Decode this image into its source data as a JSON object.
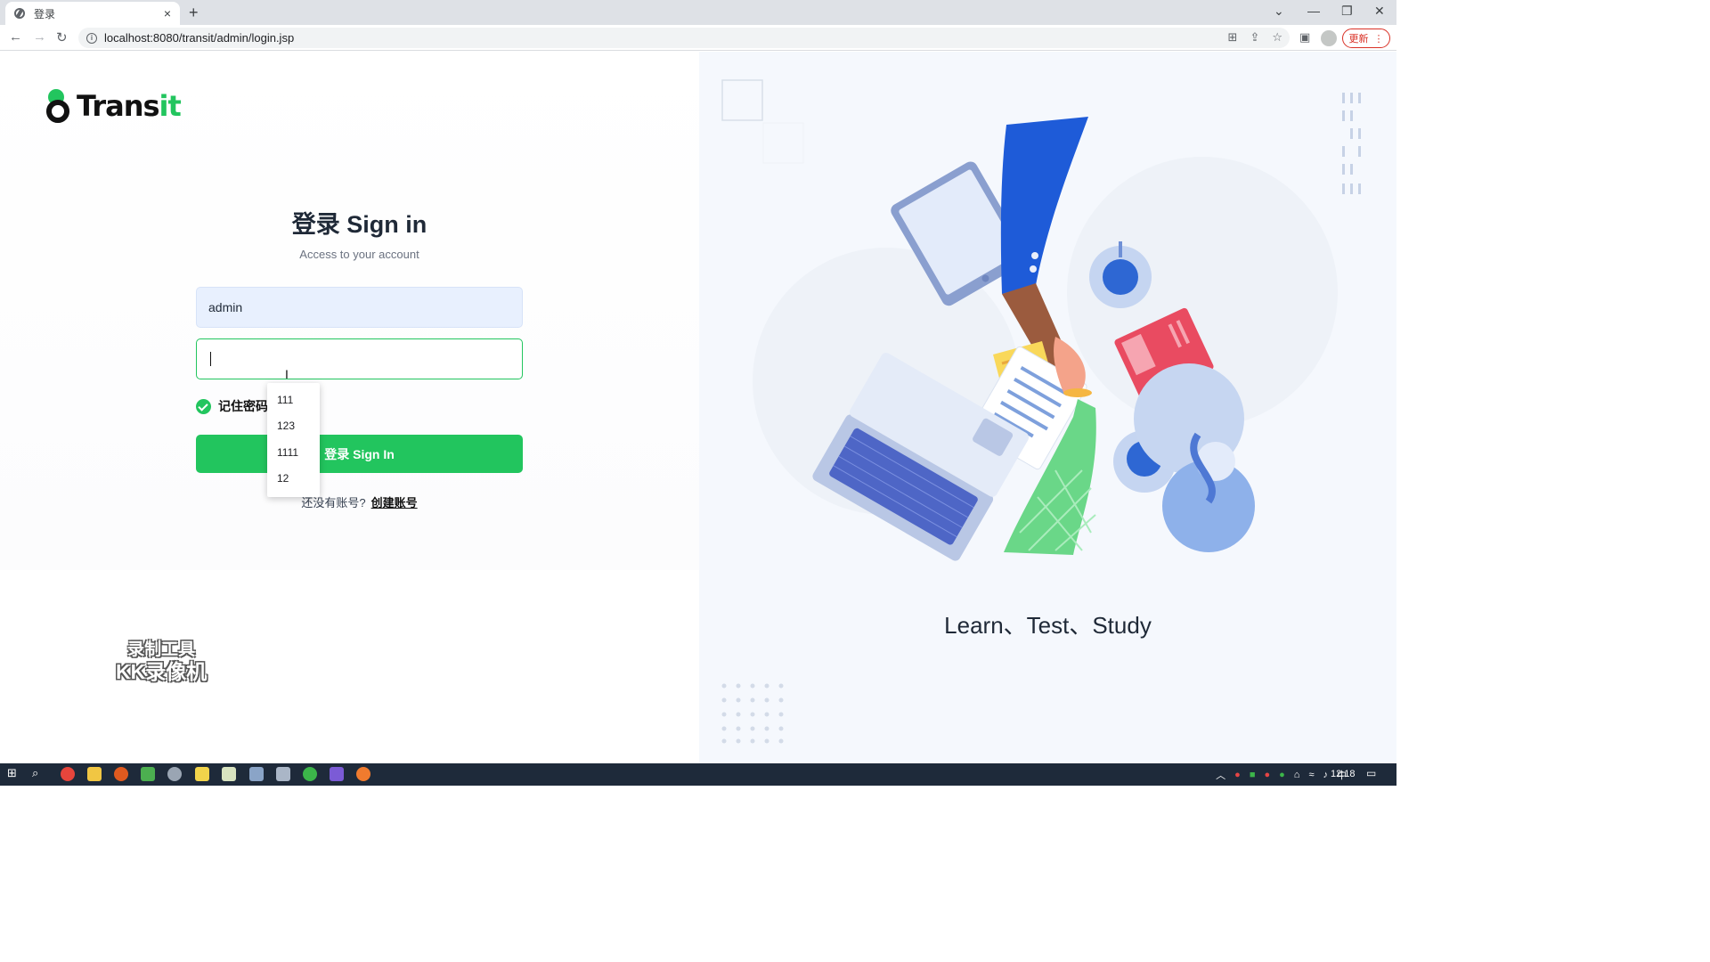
{
  "browser": {
    "tab_title": "登录",
    "tab_close": "×",
    "new_tab": "+",
    "url": "localhost:8080/transit/admin/login.jsp",
    "update_label": "更新",
    "update_menu": "⋮"
  },
  "brand": {
    "name_main": "Trans",
    "name_accent": "it"
  },
  "login": {
    "heading": "登录 Sign in",
    "subtitle": "Access to your account",
    "username_value": "admin",
    "password_value": "",
    "remember_label": "记住密码",
    "signin_label": "登录 Sign In",
    "no_account_text": "还没有账号?",
    "create_account_link": "创建账号"
  },
  "autocomplete": {
    "options": [
      "111",
      "123",
      "1111",
      "12"
    ]
  },
  "hero": {
    "tagline": "Learn、Test、Study"
  },
  "watermark": {
    "line1": "录制工具",
    "line2": "KK录像机"
  },
  "taskbar": {
    "time": "12:18",
    "ime": "中"
  },
  "colors": {
    "accent": "#22c55e",
    "dark": "#111111",
    "illustration_bg": "#f5f8fd"
  }
}
